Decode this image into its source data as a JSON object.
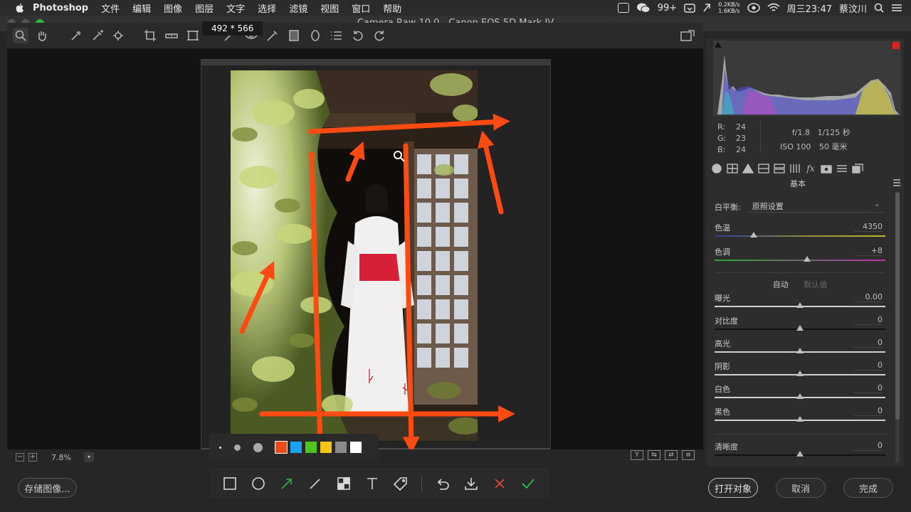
{
  "menubar": {
    "app_name": "Photoshop",
    "menus": [
      "文件",
      "编辑",
      "图像",
      "图层",
      "文字",
      "选择",
      "滤镜",
      "视图",
      "窗口",
      "帮助"
    ],
    "badge": "99+",
    "net_up": "0.2KB/s",
    "net_down": "1.6KB/s",
    "clock": "周三23:47",
    "user": "蔡汶川"
  },
  "window": {
    "title": "Camera Raw 10.0 -  Canon EOS 5D Mark IV"
  },
  "capture": {
    "size_label": "492 * 566"
  },
  "zoom": {
    "minus": "−",
    "plus": "+",
    "value": "7.8%",
    "drop": "▾"
  },
  "view_toggles": [
    "Y",
    "⇆",
    "⇄",
    "≡"
  ],
  "palette": {
    "colors": [
      "#f04a1a",
      "#1aa3f0",
      "#4dc71f",
      "#f5c518",
      "#8a8a8a",
      "#ffffff"
    ],
    "selected_color": "#f04a1a"
  },
  "annot_tools": [
    "rectangle-icon",
    "ellipse-icon",
    "arrow-icon",
    "pen-icon",
    "mosaic-icon",
    "text-icon",
    "tag-icon",
    "undo-icon",
    "download-icon",
    "close-icon",
    "confirm-icon"
  ],
  "buttons": {
    "save": "存储图像...",
    "open": "打开对象",
    "cancel": "取消",
    "done": "完成"
  },
  "readout": {
    "r_label": "R:",
    "r": "24",
    "g_label": "G:",
    "g": "23",
    "b_label": "B:",
    "b": "24",
    "aperture": "f/1.8",
    "shutter": "1/125 秒",
    "iso": "ISO 100",
    "focal": "50 毫米"
  },
  "panel": {
    "title": "基本",
    "wb_label": "白平衡:",
    "wb_value": "原照设置",
    "auto": "自动",
    "default": "默认值",
    "sliders": [
      {
        "label": "色温",
        "value": "4350",
        "pos": 0.23
      },
      {
        "label": "色调",
        "value": "+8",
        "pos": 0.54
      },
      {
        "label": "曝光",
        "value": "0.00",
        "pos": 0.5
      },
      {
        "label": "对比度",
        "value": "0",
        "pos": 0.5
      },
      {
        "label": "高光",
        "value": "0",
        "pos": 0.5
      },
      {
        "label": "阴影",
        "value": "0",
        "pos": 0.5
      },
      {
        "label": "白色",
        "value": "0",
        "pos": 0.5
      },
      {
        "label": "黑色",
        "value": "0",
        "pos": 0.5
      },
      {
        "label": "清晰度",
        "value": "0",
        "pos": 0.5
      }
    ]
  },
  "colors": {
    "accent_arrow": "#ff4a12",
    "ps_active_green": "#2cb640"
  }
}
